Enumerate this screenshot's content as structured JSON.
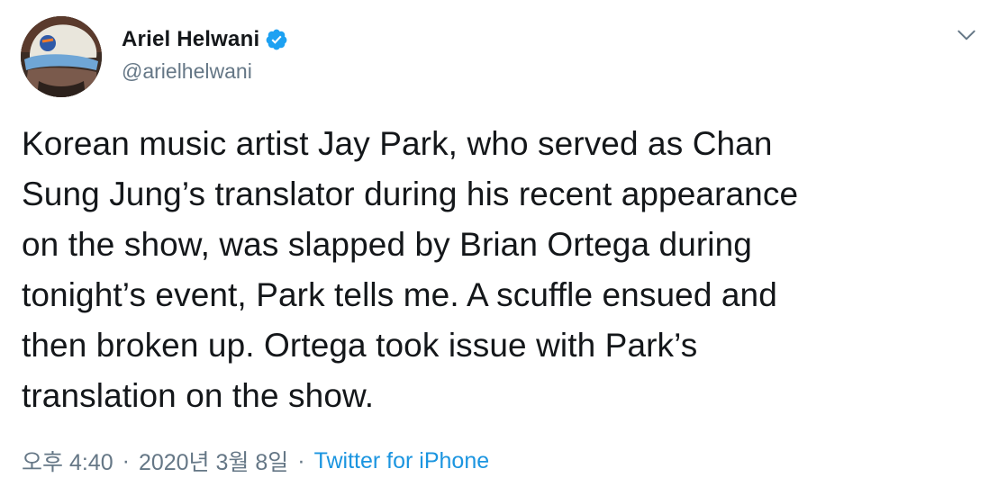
{
  "author": {
    "display_name": "Ariel Helwani",
    "handle": "@arielhelwani",
    "verified": true
  },
  "tweet": {
    "text": "Korean music artist Jay Park, who served as Chan\nSung Jung’s translator during his recent appearance\non the show, was slapped by Brian Ortega during\ntonight’s event, Park tells me. A scuffle ensued and\nthen broken up. Ortega took issue with Park’s\ntranslation on the show."
  },
  "meta": {
    "time": "오후 4:40",
    "date": "2020년 3월 8일",
    "separator": "·",
    "source": "Twitter for iPhone"
  },
  "icons": {
    "verified": "verified-badge-icon",
    "menu": "chevron-down-icon"
  },
  "colors": {
    "text": "#14171a",
    "secondary": "#657786",
    "link": "#1b95e0",
    "verified": "#1da1f2"
  }
}
